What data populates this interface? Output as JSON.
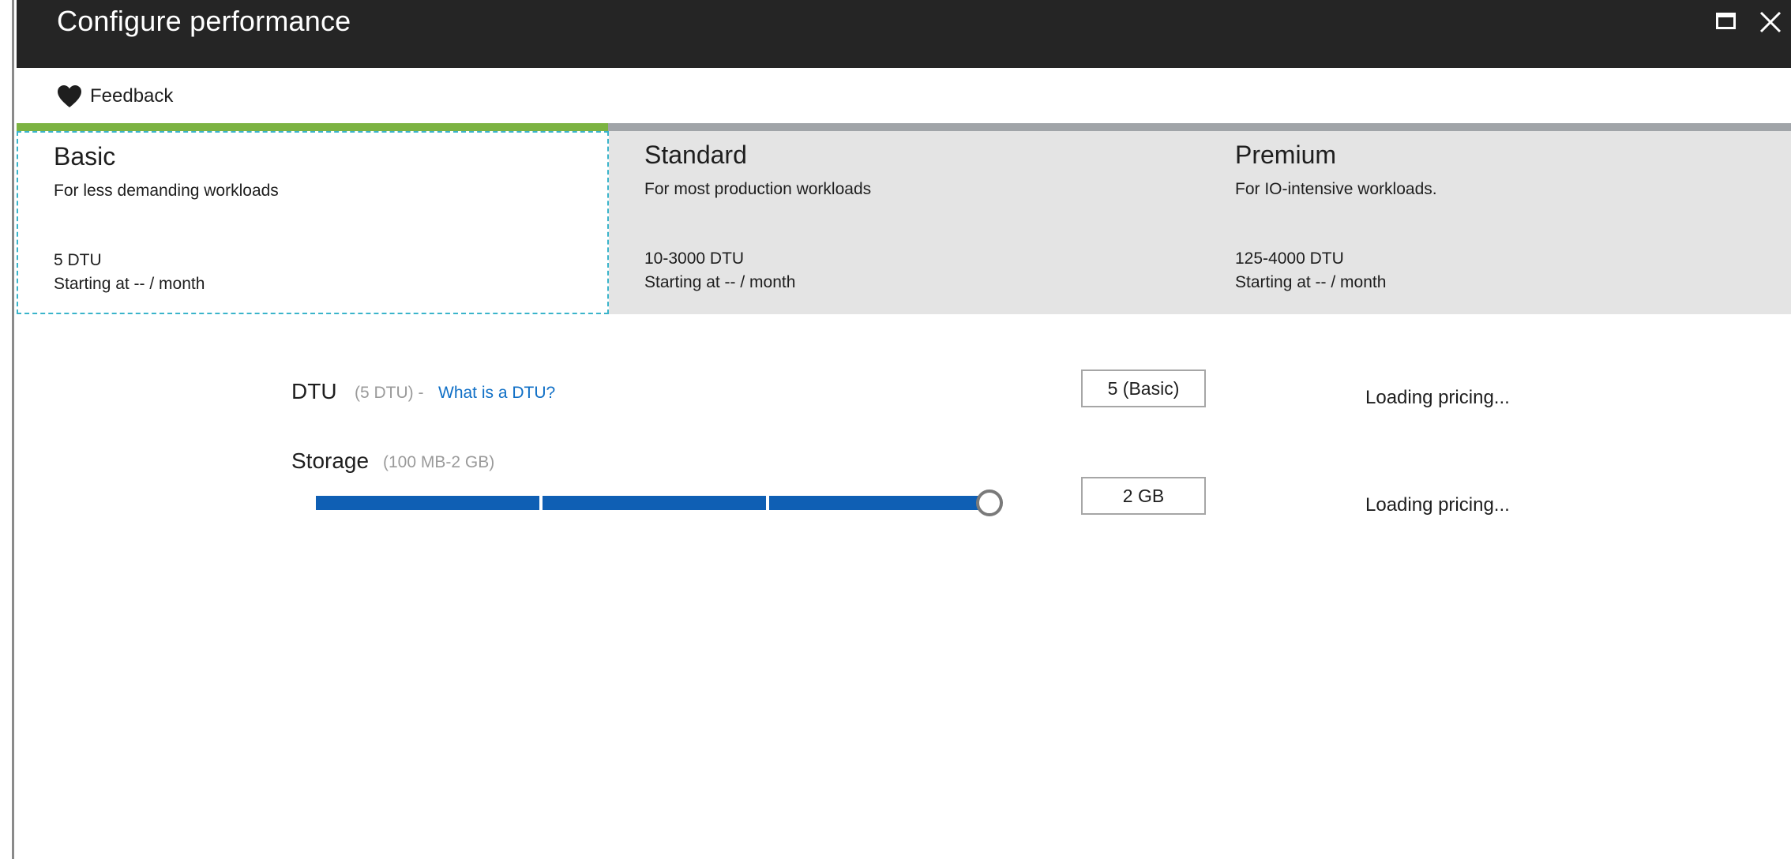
{
  "window": {
    "title": "Configure performance",
    "maximize_icon": "maximize-icon",
    "close_icon": "close-icon"
  },
  "toolbar": {
    "feedback_label": "Feedback",
    "feedback_icon": "heart-icon"
  },
  "tiers": [
    {
      "name": "Basic",
      "description": "For less demanding workloads",
      "dtu": "5 DTU",
      "price": "Starting at -- / month",
      "selected": true
    },
    {
      "name": "Standard",
      "description": "For most production workloads",
      "dtu": "10-3000 DTU",
      "price": "Starting at -- / month",
      "selected": false
    },
    {
      "name": "Premium",
      "description": "For IO-intensive workloads.",
      "dtu": "125-4000 DTU",
      "price": "Starting at -- / month",
      "selected": false
    }
  ],
  "dtu": {
    "label": "DTU",
    "hint": "(5 DTU) -",
    "link": "What is a DTU?",
    "value": "5 (Basic)",
    "pricing": "Loading pricing..."
  },
  "storage": {
    "label": "Storage",
    "hint": "(100 MB-2 GB)",
    "value": "2 GB",
    "pricing": "Loading pricing...",
    "slider_fraction": 1.0
  },
  "colors": {
    "title_bar": "#252525",
    "selected_tier_accent": "#7cb342",
    "tier_bar": "#a0a4a8",
    "tier_background": "#e4e4e4",
    "selected_border": "#3ab4ca",
    "slider_fill": "#0f5fb4",
    "link": "#0f6fc6"
  }
}
